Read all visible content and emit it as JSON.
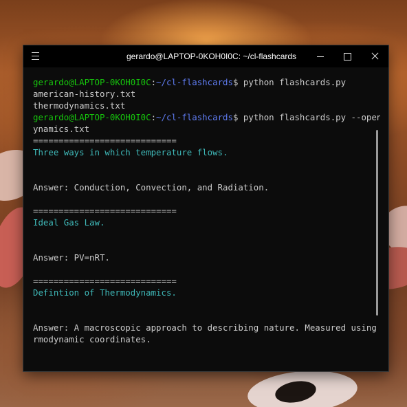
{
  "window": {
    "title": "gerardo@LAPTOP-0KOH0I0C: ~/cl-flashcards"
  },
  "colors": {
    "prompt_user": "#16c60c",
    "prompt_path": "#5f7cf2",
    "question_text": "#3fb9b9",
    "default_text": "#cccccc"
  },
  "icons": {
    "menu": "hamburger-icon",
    "minimize": "minimize-icon",
    "maximize": "maximize-icon",
    "close": "close-icon"
  },
  "terminal": {
    "prompt1": {
      "user": "gerardo@LAPTOP-0KOH0I0C",
      "sep": ":",
      "path": "~/cl-flashcards",
      "symbol": "$ ",
      "command": "python flashcards.py"
    },
    "ls_output": [
      "american-history.txt",
      "thermodynamics.txt"
    ],
    "prompt2": {
      "user": "gerardo@LAPTOP-0KOH0I0C",
      "sep": ":",
      "path": "~/cl-flashcards",
      "symbol": "$ ",
      "command": "python flashcards.py --openfil",
      "command_wrap": "ynamics.txt"
    },
    "separator": "============================",
    "cards": [
      {
        "question": "Three ways in which temperature flows.",
        "answer": "Answer: Conduction, Convection, and Radiation."
      },
      {
        "question": "Ideal Gas Law.",
        "answer": "Answer: PV=nRT."
      },
      {
        "question": "Defintion of Thermodynamics.",
        "answer": "Answer: A macroscopic approach to describing nature. Measured using the",
        "answer_wrap": "rmodynamic coordinates."
      }
    ]
  }
}
